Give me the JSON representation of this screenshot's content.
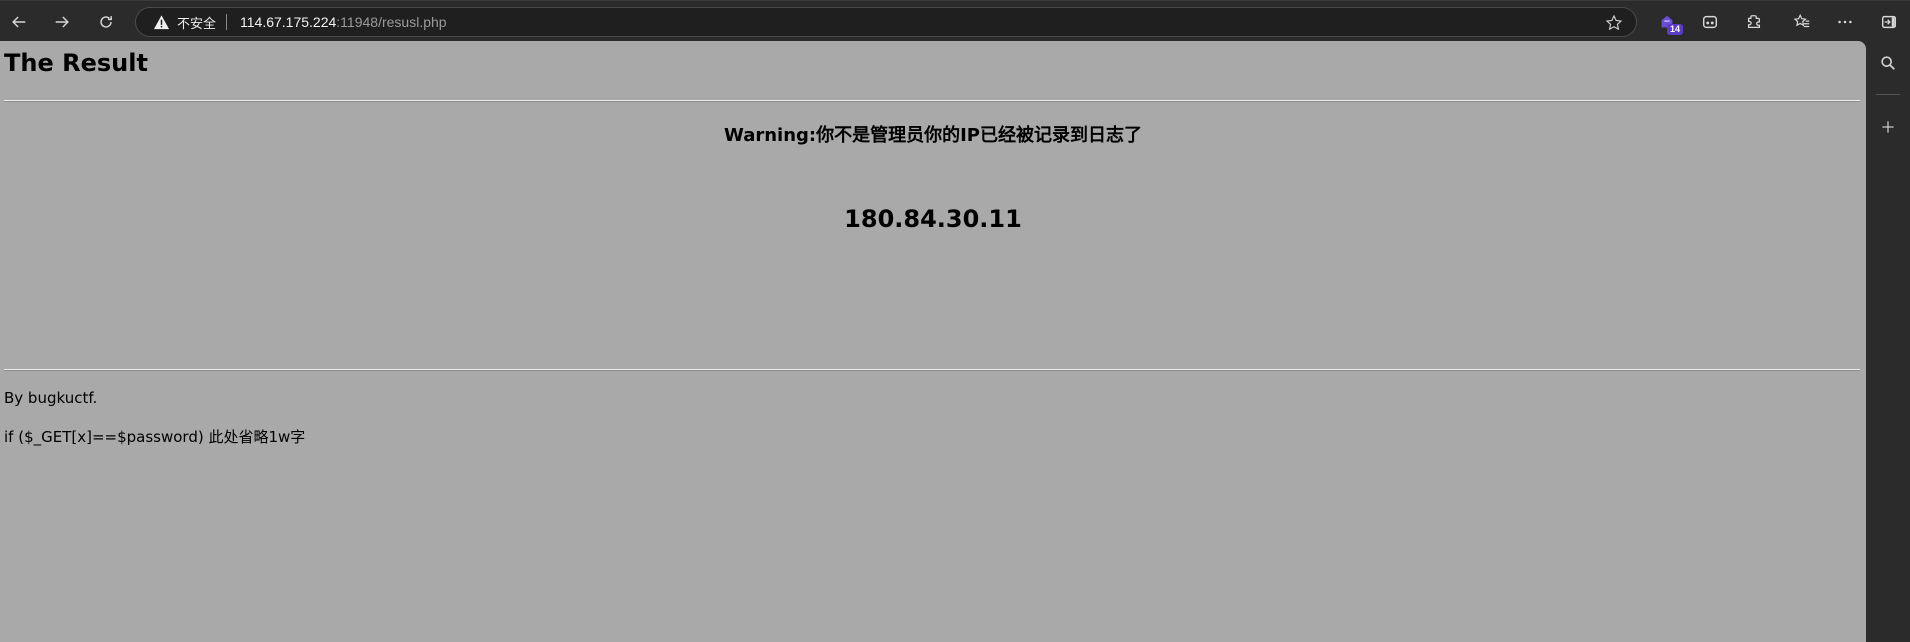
{
  "browser": {
    "security_label": "不安全",
    "url_host": "114.67.175.224",
    "url_rest": ":11948/resusl.php",
    "extension_badge": "14",
    "accent_color": "#5b3cc4"
  },
  "icons": {
    "back": "back-arrow-icon",
    "forward": "forward-arrow-icon",
    "reload": "reload-icon",
    "warning": "warning-triangle-icon",
    "favorite": "star-icon",
    "extension": "extension-icon",
    "reader": "immersive-reader-icon",
    "puzzle": "extensions-icon",
    "favorites_list": "favorites-icon",
    "more": "more-dots-icon",
    "sidebar": "sidebar-toggle-icon",
    "search": "search-icon",
    "add": "plus-icon"
  },
  "page": {
    "title": "The Result",
    "warning": "Warning:你不是管理员你的IP已经被记录到日志了",
    "ip": "180.84.30.11",
    "byline": "By bugkuctf.",
    "hint": "if ($_GET[x]==$password) 此处省略1w字"
  }
}
